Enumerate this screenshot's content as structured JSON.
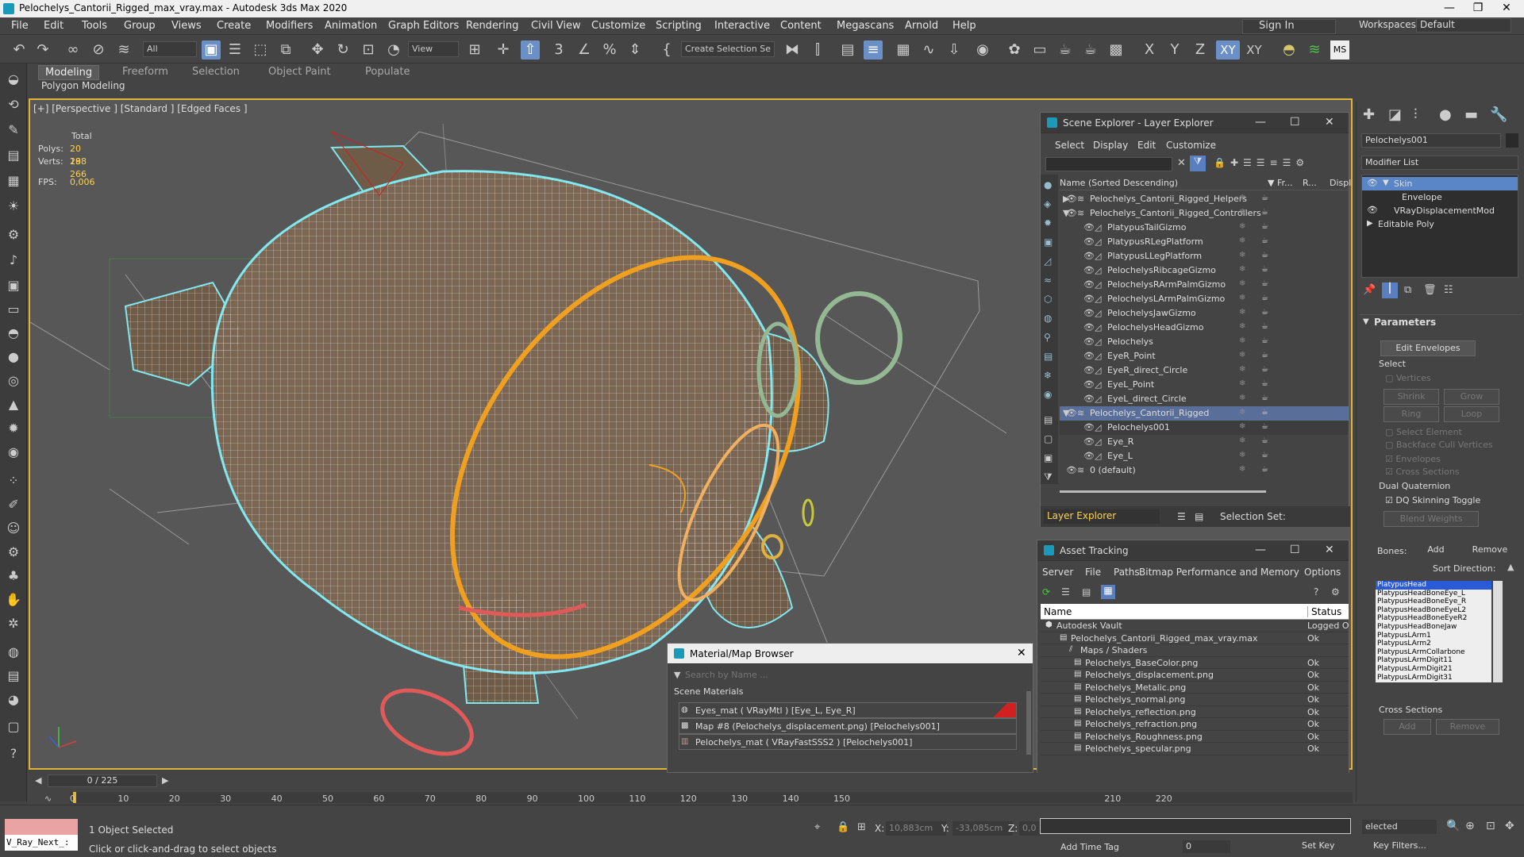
{
  "window": {
    "title": "Pelochelys_Cantorii_Rigged_max_vray.max - Autodesk 3ds Max 2020",
    "controls": [
      "—",
      "❐",
      "✕"
    ]
  },
  "menu": [
    "File",
    "Edit",
    "Tools",
    "Group",
    "Views",
    "Create",
    "Modifiers",
    "Animation",
    "Graph Editors",
    "Rendering",
    "Civil View",
    "Customize",
    "Scripting",
    "Interactive",
    "Content",
    "Megascans",
    "Arnold",
    "Help"
  ],
  "signin": "Sign In",
  "workspaces": {
    "label": "Workspaces:",
    "value": "Default"
  },
  "toolbar": {
    "filter_select": "All",
    "view_select": "View",
    "selection_set": "Create Selection Se",
    "axis": [
      "X",
      "Y",
      "Z",
      "XY",
      "XY"
    ]
  },
  "ribbon": {
    "tabs": [
      "Modeling",
      "Freeform",
      "Selection",
      "Object Paint",
      "Populate"
    ],
    "subtab": "Polygon Modeling"
  },
  "viewport": {
    "label": "[+] [Perspective ] [Standard ] [Edged Faces ]",
    "stats": {
      "total": "Total",
      "polys_label": "Polys:",
      "polys": "20 298",
      "verts_label": "Verts:",
      "verts": "18 266",
      "fps_label": "FPS:",
      "fps": "0,006"
    }
  },
  "scene_explorer": {
    "title": "Scene Explorer - Layer Explorer",
    "menu": [
      "Select",
      "Display",
      "Edit",
      "Customize"
    ],
    "col_name": "Name (Sorted Descending)",
    "col_frozen": "▼ Fr...",
    "col_render": "R...",
    "col_display": "Displ",
    "rows": [
      "Pelochelys_Cantorii_Rigged_Helpers",
      "Pelochelys_Cantorii_Rigged_Controllers",
      "PlatypusTailGizmo",
      "PlatypusRLegPlatform",
      "PlatypusLLegPlatform",
      "PelochelysRibcageGizmo",
      "PelochelysRArmPalmGizmo",
      "PelochelysLArmPalmGizmo",
      "PelochelysJawGizmo",
      "PelochelysHeadGizmo",
      "Pelochelys",
      "EyeR_Point",
      "EyeR_direct_Circle",
      "EyeL_Point",
      "EyeL_direct_Circle",
      "Pelochelys_Cantorii_Rigged",
      "Pelochelys001",
      "Eye_R",
      "Eye_L",
      "0 (default)"
    ],
    "footer_layer": "Layer Explorer",
    "footer_selset": "Selection Set:"
  },
  "asset_tracking": {
    "title": "Asset Tracking",
    "menu": [
      "Server",
      "File",
      "Paths",
      "Bitmap Performance and Memory",
      "Options"
    ],
    "col_name": "Name",
    "col_status": "Status",
    "rows": [
      {
        "name": "Autodesk Vault",
        "status": "Logged O"
      },
      {
        "name": "Pelochelys_Cantorii_Rigged_max_vray.max",
        "status": "Ok"
      },
      {
        "name": "Maps / Shaders",
        "status": ""
      },
      {
        "name": "Pelochelys_BaseColor.png",
        "status": "Ok"
      },
      {
        "name": "Pelochelys_displacement.png",
        "status": "Ok"
      },
      {
        "name": "Pelochelys_Metalic.png",
        "status": "Ok"
      },
      {
        "name": "Pelochelys_normal.png",
        "status": "Ok"
      },
      {
        "name": "Pelochelys_reflection.png",
        "status": "Ok"
      },
      {
        "name": "Pelochelys_refraction.png",
        "status": "Ok"
      },
      {
        "name": "Pelochelys_Roughness.png",
        "status": "Ok"
      },
      {
        "name": "Pelochelys_specular.png",
        "status": "Ok"
      }
    ]
  },
  "material_browser": {
    "title": "Material/Map Browser",
    "search_placeholder": "Search by Name ...",
    "section": "Scene Materials",
    "items": [
      "Eyes_mat  ( VRayMtl )  [Eye_L, Eye_R]",
      "Map #8 (Pelochelys_displacement.png) [Pelochelys001]",
      "Pelochelys_mat  ( VRayFastSSS2 )  [Pelochelys001]"
    ]
  },
  "command_panel": {
    "object_name": "Pelochelys001",
    "modifier_list": "Modifier List",
    "stack": [
      "Skin",
      "Envelope",
      "VRayDisplacementMod",
      "Editable Poly"
    ],
    "parameters": "Parameters",
    "edit_envelopes": "Edit Envelopes",
    "select_label": "Select",
    "vertices": "Vertices",
    "shrink": "Shrink",
    "grow": "Grow",
    "ring": "Ring",
    "loop": "Loop",
    "select_element": "Select Element",
    "backface": "Backface Cull Vertices",
    "envelopes": "Envelopes",
    "cross_sections": "Cross Sections",
    "dual_quaternion": "Dual Quaternion",
    "dq_toggle": "DQ Skinning Toggle",
    "blend_weights": "Blend Weights",
    "bones_label": "Bones:",
    "add": "Add",
    "remove": "Remove",
    "sort_direction": "Sort Direction:",
    "bones": [
      "PlatypusHead",
      "PlatypusHeadBoneEye_L",
      "PlatypusHeadBoneEye_R",
      "PlatypusHeadBoneEyeL2",
      "PlatypusHeadBoneEyeR2",
      "PlatypusHeadBoneJaw",
      "PlatypusLArm1",
      "PlatypusLArm2",
      "PlatypusLArmCollarbone",
      "PlatypusLArmDigit11",
      "PlatypusLArmDigit21",
      "PlatypusLArmDigit31"
    ],
    "cross_sections_group": "Cross Sections",
    "cs_add": "Add",
    "cs_remove": "Remove"
  },
  "timeline": {
    "frame": "0 / 225",
    "ticks": [
      "0",
      "10",
      "20",
      "30",
      "40",
      "50",
      "60",
      "70",
      "80",
      "90",
      "100",
      "110",
      "120",
      "130",
      "140",
      "150",
      "210",
      "220"
    ]
  },
  "statusbar": {
    "script": "V_Ray_Next_:",
    "objects_selected": "1 Object Selected",
    "hint": "Click or click-and-drag to select objects",
    "x_label": "X:",
    "x_value": "10,883cm",
    "y_label": "Y:",
    "y_value": "-33,085cm",
    "z_label": "Z:",
    "z_value": "0,0",
    "add_time_tag": "Add Time Tag",
    "frame_field": "0",
    "set_key": "Set Key",
    "key_filters": "Key Filters...",
    "selected": "elected"
  }
}
